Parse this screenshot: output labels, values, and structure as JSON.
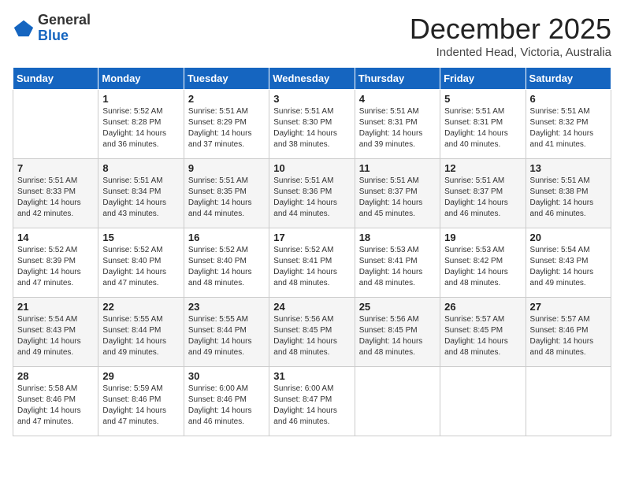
{
  "header": {
    "logo_general": "General",
    "logo_blue": "Blue",
    "month_title": "December 2025",
    "subtitle": "Indented Head, Victoria, Australia"
  },
  "days_of_week": [
    "Sunday",
    "Monday",
    "Tuesday",
    "Wednesday",
    "Thursday",
    "Friday",
    "Saturday"
  ],
  "weeks": [
    [
      {
        "day": "",
        "sunrise": "",
        "sunset": "",
        "daylight": ""
      },
      {
        "day": "1",
        "sunrise": "Sunrise: 5:52 AM",
        "sunset": "Sunset: 8:28 PM",
        "daylight": "Daylight: 14 hours and 36 minutes."
      },
      {
        "day": "2",
        "sunrise": "Sunrise: 5:51 AM",
        "sunset": "Sunset: 8:29 PM",
        "daylight": "Daylight: 14 hours and 37 minutes."
      },
      {
        "day": "3",
        "sunrise": "Sunrise: 5:51 AM",
        "sunset": "Sunset: 8:30 PM",
        "daylight": "Daylight: 14 hours and 38 minutes."
      },
      {
        "day": "4",
        "sunrise": "Sunrise: 5:51 AM",
        "sunset": "Sunset: 8:31 PM",
        "daylight": "Daylight: 14 hours and 39 minutes."
      },
      {
        "day": "5",
        "sunrise": "Sunrise: 5:51 AM",
        "sunset": "Sunset: 8:31 PM",
        "daylight": "Daylight: 14 hours and 40 minutes."
      },
      {
        "day": "6",
        "sunrise": "Sunrise: 5:51 AM",
        "sunset": "Sunset: 8:32 PM",
        "daylight": "Daylight: 14 hours and 41 minutes."
      }
    ],
    [
      {
        "day": "7",
        "sunrise": "Sunrise: 5:51 AM",
        "sunset": "Sunset: 8:33 PM",
        "daylight": "Daylight: 14 hours and 42 minutes."
      },
      {
        "day": "8",
        "sunrise": "Sunrise: 5:51 AM",
        "sunset": "Sunset: 8:34 PM",
        "daylight": "Daylight: 14 hours and 43 minutes."
      },
      {
        "day": "9",
        "sunrise": "Sunrise: 5:51 AM",
        "sunset": "Sunset: 8:35 PM",
        "daylight": "Daylight: 14 hours and 44 minutes."
      },
      {
        "day": "10",
        "sunrise": "Sunrise: 5:51 AM",
        "sunset": "Sunset: 8:36 PM",
        "daylight": "Daylight: 14 hours and 44 minutes."
      },
      {
        "day": "11",
        "sunrise": "Sunrise: 5:51 AM",
        "sunset": "Sunset: 8:37 PM",
        "daylight": "Daylight: 14 hours and 45 minutes."
      },
      {
        "day": "12",
        "sunrise": "Sunrise: 5:51 AM",
        "sunset": "Sunset: 8:37 PM",
        "daylight": "Daylight: 14 hours and 46 minutes."
      },
      {
        "day": "13",
        "sunrise": "Sunrise: 5:51 AM",
        "sunset": "Sunset: 8:38 PM",
        "daylight": "Daylight: 14 hours and 46 minutes."
      }
    ],
    [
      {
        "day": "14",
        "sunrise": "Sunrise: 5:52 AM",
        "sunset": "Sunset: 8:39 PM",
        "daylight": "Daylight: 14 hours and 47 minutes."
      },
      {
        "day": "15",
        "sunrise": "Sunrise: 5:52 AM",
        "sunset": "Sunset: 8:40 PM",
        "daylight": "Daylight: 14 hours and 47 minutes."
      },
      {
        "day": "16",
        "sunrise": "Sunrise: 5:52 AM",
        "sunset": "Sunset: 8:40 PM",
        "daylight": "Daylight: 14 hours and 48 minutes."
      },
      {
        "day": "17",
        "sunrise": "Sunrise: 5:52 AM",
        "sunset": "Sunset: 8:41 PM",
        "daylight": "Daylight: 14 hours and 48 minutes."
      },
      {
        "day": "18",
        "sunrise": "Sunrise: 5:53 AM",
        "sunset": "Sunset: 8:41 PM",
        "daylight": "Daylight: 14 hours and 48 minutes."
      },
      {
        "day": "19",
        "sunrise": "Sunrise: 5:53 AM",
        "sunset": "Sunset: 8:42 PM",
        "daylight": "Daylight: 14 hours and 48 minutes."
      },
      {
        "day": "20",
        "sunrise": "Sunrise: 5:54 AM",
        "sunset": "Sunset: 8:43 PM",
        "daylight": "Daylight: 14 hours and 49 minutes."
      }
    ],
    [
      {
        "day": "21",
        "sunrise": "Sunrise: 5:54 AM",
        "sunset": "Sunset: 8:43 PM",
        "daylight": "Daylight: 14 hours and 49 minutes."
      },
      {
        "day": "22",
        "sunrise": "Sunrise: 5:55 AM",
        "sunset": "Sunset: 8:44 PM",
        "daylight": "Daylight: 14 hours and 49 minutes."
      },
      {
        "day": "23",
        "sunrise": "Sunrise: 5:55 AM",
        "sunset": "Sunset: 8:44 PM",
        "daylight": "Daylight: 14 hours and 49 minutes."
      },
      {
        "day": "24",
        "sunrise": "Sunrise: 5:56 AM",
        "sunset": "Sunset: 8:45 PM",
        "daylight": "Daylight: 14 hours and 48 minutes."
      },
      {
        "day": "25",
        "sunrise": "Sunrise: 5:56 AM",
        "sunset": "Sunset: 8:45 PM",
        "daylight": "Daylight: 14 hours and 48 minutes."
      },
      {
        "day": "26",
        "sunrise": "Sunrise: 5:57 AM",
        "sunset": "Sunset: 8:45 PM",
        "daylight": "Daylight: 14 hours and 48 minutes."
      },
      {
        "day": "27",
        "sunrise": "Sunrise: 5:57 AM",
        "sunset": "Sunset: 8:46 PM",
        "daylight": "Daylight: 14 hours and 48 minutes."
      }
    ],
    [
      {
        "day": "28",
        "sunrise": "Sunrise: 5:58 AM",
        "sunset": "Sunset: 8:46 PM",
        "daylight": "Daylight: 14 hours and 47 minutes."
      },
      {
        "day": "29",
        "sunrise": "Sunrise: 5:59 AM",
        "sunset": "Sunset: 8:46 PM",
        "daylight": "Daylight: 14 hours and 47 minutes."
      },
      {
        "day": "30",
        "sunrise": "Sunrise: 6:00 AM",
        "sunset": "Sunset: 8:46 PM",
        "daylight": "Daylight: 14 hours and 46 minutes."
      },
      {
        "day": "31",
        "sunrise": "Sunrise: 6:00 AM",
        "sunset": "Sunset: 8:47 PM",
        "daylight": "Daylight: 14 hours and 46 minutes."
      },
      {
        "day": "",
        "sunrise": "",
        "sunset": "",
        "daylight": ""
      },
      {
        "day": "",
        "sunrise": "",
        "sunset": "",
        "daylight": ""
      },
      {
        "day": "",
        "sunrise": "",
        "sunset": "",
        "daylight": ""
      }
    ]
  ]
}
